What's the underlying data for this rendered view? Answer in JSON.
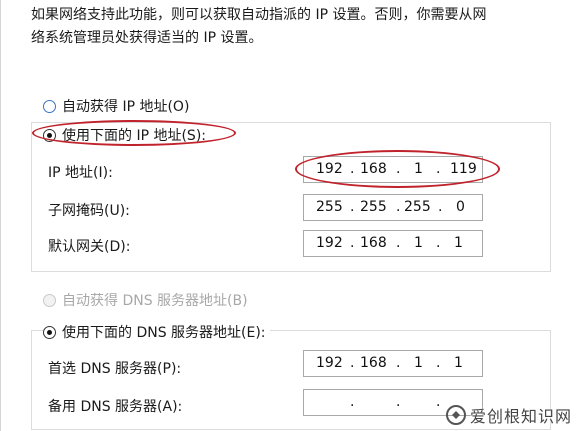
{
  "description_text": [
    "如果网络支持此功能，则可以获取自动指派的 IP 设置。否则，你需要从网",
    "络系统管理员处获得适当的 IP 设置。"
  ],
  "ip_section": {
    "auto_ip_label": "自动获得 IP 地址(O)",
    "manual_ip_label": "使用下面的 IP 地址(S):",
    "ip_label": "IP 地址(I):",
    "ip_octets": [
      "192",
      "168",
      "1",
      "119"
    ],
    "subnet_label": "子网掩码(U):",
    "subnet_octets": [
      "255",
      "255",
      "255",
      "0"
    ],
    "gateway_label": "默认网关(D):",
    "gateway_octets": [
      "192",
      "168",
      "1",
      "1"
    ]
  },
  "dns_section": {
    "auto_dns_label": "自动获得 DNS 服务器地址(B)",
    "manual_dns_label": "使用下面的 DNS 服务器地址(E):",
    "preferred_label": "首选 DNS 服务器(P):",
    "preferred_octets": [
      "192",
      "168",
      "1",
      "1"
    ],
    "alternate_label": "备用 DNS 服务器(A):",
    "alternate_octets": [
      "",
      "",
      "",
      ""
    ]
  },
  "watermark": "爱创根知识网",
  "colors": {
    "annotation_red": "#c0232c",
    "radio_blue": "#3a73c6"
  }
}
